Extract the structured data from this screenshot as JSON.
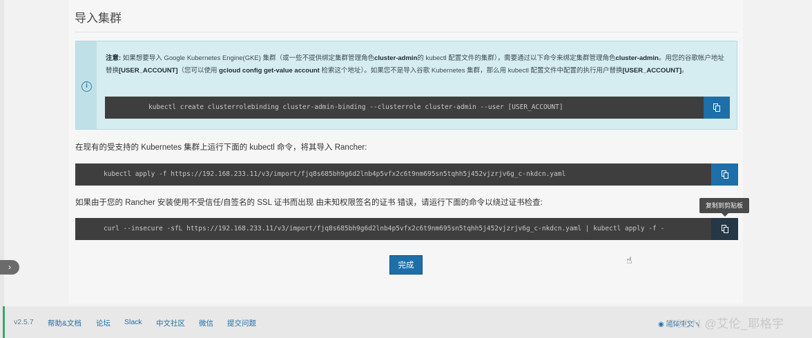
{
  "page": {
    "title": "导入集群"
  },
  "note": {
    "label": "注意:",
    "text_1": " 如果想要导入 Google Kubernetes Engine(GKE) 集群（或一些不提供绑定集群管理角色",
    "bold_1": "cluster-admin",
    "text_2": "的 kubectl 配置文件的集群），需要通过以下命令来绑定集群管理角色",
    "bold_2": "cluster-admin",
    "text_3": "。用您的谷歌帐户地址替换",
    "bold_3": "[USER_ACCOUNT]",
    "text_4": "（您可以使用 ",
    "bold_4": "gcloud config get-value account",
    "text_5": " 检索这个地址）。如果您不是导入谷歌 Kubernetes 集群，那么用 kubectl 配置文件中配置的执行用户替换",
    "bold_5": "[USER_ACCOUNT]",
    "text_6": "。",
    "command": "kubectl create clusterrolebinding cluster-admin-binding --clusterrole cluster-admin --user [USER_ACCOUNT]"
  },
  "instructions": {
    "supported": "在现有的受支持的 Kubernetes 集群上运行下面的 kubectl 命令，将其导入 Rancher:",
    "supported_command": "kubectl apply -f https://192.168.233.11/v3/import/fjq8s685bh9g6d2lnb4p5vfx2c6t9nm695sn5tqhh5j452vjzrjv6g_c-nkdcn.yaml",
    "insecure": "如果由于您的 Rancher 安装使用不受信任/自签名的 SSL 证书而出现 由未知权限签名的证书 错误，请运行下面的命令以绕过证书检查:",
    "insecure_command": "curl --insecure -sfL https://192.168.233.11/v3/import/fjq8s685bh9g6d2lnb4p5vfx2c6t9nm695sn5tqhh5j452vjzrjv6g_c-nkdcn.yaml | kubectl apply -f -"
  },
  "tooltip": "复制到剪贴板",
  "done_button": "完成",
  "sidebar_toggle": "›",
  "footer": {
    "version": "v2.5.7",
    "links": [
      "帮助&文档",
      "论坛",
      "Slack",
      "中文社区",
      "微信",
      "提交问题"
    ],
    "language": "简体中文 ∨",
    "watermark": "CSDN @艾伦_耶格宇"
  },
  "colors": {
    "accent": "#1e6fa8",
    "note_bg": "#d5ecf0",
    "code_bg": "#3e3e3e"
  },
  "icons": [
    "info-icon",
    "copy-icon",
    "chevron-right-icon",
    "globe-icon",
    "mouse-pointer-icon"
  ]
}
